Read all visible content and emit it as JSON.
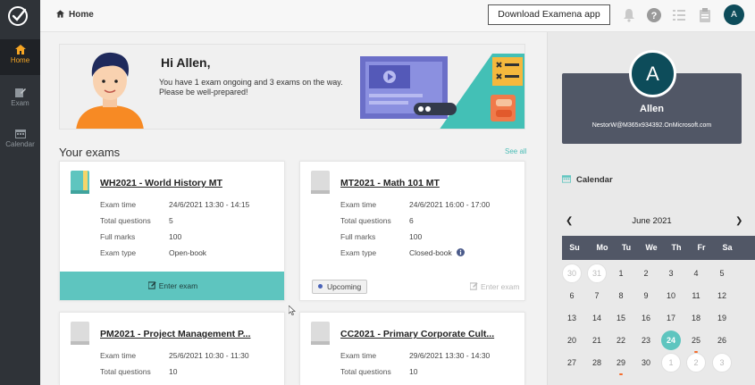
{
  "nav": {
    "items": [
      {
        "label": "Home"
      },
      {
        "label": "Exam"
      },
      {
        "label": "Calendar"
      }
    ]
  },
  "topbar": {
    "breadcrumb": "Home",
    "download_label": "Download Examena app",
    "avatar_initial": "A"
  },
  "banner": {
    "greeting": "Hi Allen,",
    "message_line1": "You have 1 exam ongoing and 3 exams on the way.",
    "message_line2": "Please be well-prepared!"
  },
  "exams": {
    "title": "Your exams",
    "see_all": "See all",
    "cards": [
      {
        "title": "WH2021 - World History MT",
        "rows": [
          [
            "Exam time",
            "24/6/2021 13:30 - 14:15"
          ],
          [
            "Total questions",
            "5"
          ],
          [
            "Full marks",
            "100"
          ],
          [
            "Exam type",
            "Open-book"
          ]
        ],
        "action": "Enter exam"
      },
      {
        "title": "MT2021 - Math 101 MT",
        "rows": [
          [
            "Exam time",
            "24/6/2021 16:00 - 17:00"
          ],
          [
            "Total questions",
            "6"
          ],
          [
            "Full marks",
            "100"
          ],
          [
            "Exam type",
            "Closed-book"
          ]
        ],
        "status": "Upcoming",
        "action": "Enter exam"
      },
      {
        "title": "PM2021 - Project Management P...",
        "rows": [
          [
            "Exam time",
            "25/6/2021 10:30 - 11:30"
          ],
          [
            "Total questions",
            "10"
          ]
        ]
      },
      {
        "title": "CC2021 - Primary Corporate Cult...",
        "rows": [
          [
            "Exam time",
            "29/6/2021 13:30 - 14:30"
          ],
          [
            "Total questions",
            "10"
          ]
        ]
      }
    ]
  },
  "profile": {
    "initial": "A",
    "name": "Allen",
    "email": "NestorW@M365x934392.OnMicrosoft.com"
  },
  "calendar": {
    "title": "Calendar",
    "month": "June 2021",
    "days_of_week": [
      "Su",
      "Mo",
      "Tu",
      "We",
      "Th",
      "Fr",
      "Sa"
    ],
    "weeks": [
      [
        "30",
        "31",
        "1",
        "2",
        "3",
        "4",
        "5"
      ],
      [
        "6",
        "7",
        "8",
        "9",
        "10",
        "11",
        "12"
      ],
      [
        "13",
        "14",
        "15",
        "16",
        "17",
        "18",
        "19"
      ],
      [
        "20",
        "21",
        "22",
        "23",
        "24",
        "25",
        "26"
      ],
      [
        "27",
        "28",
        "29",
        "30",
        "1",
        "2",
        "3"
      ]
    ],
    "today": "24",
    "marked_days": [
      "25",
      "29"
    ]
  }
}
